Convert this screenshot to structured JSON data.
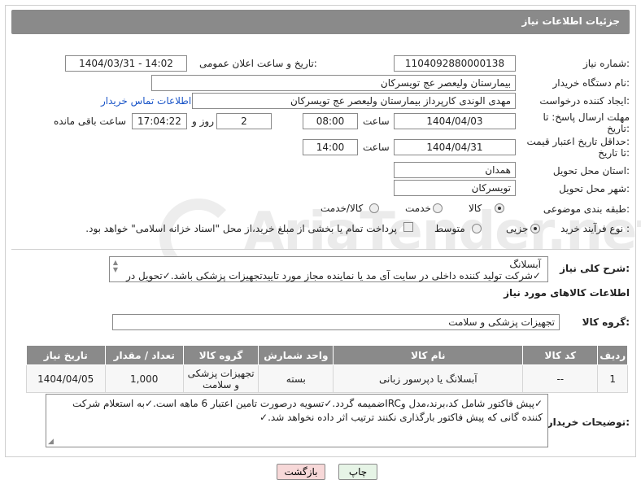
{
  "header": {
    "title": "جزئیات اطلاعات نیاز"
  },
  "form": {
    "need_number": {
      "label": "شماره نیاز:",
      "value": "1104092880000138"
    },
    "announce_datetime": {
      "label": "تاریخ و ساعت اعلان عمومی:",
      "value": "1404/03/31 - 14:02"
    },
    "buyer_org": {
      "label": "نام دستگاه خریدار:",
      "value": "بیمارستان ولیعصر  عج  تویسرکان"
    },
    "requester": {
      "label": "ایجاد کننده درخواست:",
      "value": "مهدی الوندی کارپرداز بیمارستان ولیعصر  عج  تویسرکان",
      "contact_link": "اطلاعات تماس خریدار"
    },
    "reply_deadline": {
      "label_line1": "مهلت ارسال پاسخ: تا",
      "label_line2": "تاریخ:",
      "date": "1404/04/03",
      "time_label": "ساعت",
      "time": "08:00",
      "days": "2",
      "days_label": "روز و",
      "remaining": "17:04:22",
      "remaining_label": "ساعت باقی مانده"
    },
    "price_validity": {
      "label_line1": "حداقل تاریخ اعتبار قیمت:",
      "label_line2": "تا تاریخ:",
      "date": "1404/04/31",
      "time_label": "ساعت",
      "time": "14:00"
    },
    "delivery_province": {
      "label": "استان محل تحویل:",
      "value": "همدان"
    },
    "delivery_city": {
      "label": "شهر محل تحویل:",
      "value": "تویسرکان"
    },
    "category": {
      "label": "طبقه بندی موضوعی:",
      "options": [
        "کالا",
        "خدمت",
        "کالا/خدمت"
      ],
      "selected": "کالا"
    },
    "purchase_process": {
      "label": "نوع فرآیند خرید :",
      "options": [
        "جزیی",
        "متوسط"
      ],
      "selected": "جزیی",
      "payment_note": "پرداخت تمام یا بخشی از مبلغ خرید،از محل \"اسناد خزانه اسلامی\" خواهد بود."
    }
  },
  "description": {
    "label": "شرح کلی نیاز:",
    "line1": "آبسلانگ",
    "line2": "✓شرکت تولید کننده داخلی در سایت آی مد یا نماینده مجاز مورد تاییدتجهیزات پزشکی باشد.✓تحویل در"
  },
  "goods_info": {
    "title": "اطلاعات کالاهای مورد نیاز",
    "group_label": "گروه کالا:",
    "group_value": "تجهیزات پزشکی و سلامت"
  },
  "table": {
    "headers": [
      "ردیف",
      "کد کالا",
      "نام کالا",
      "واحد شمارش",
      "گروه کالا",
      "تعداد / مقدار",
      "تاریخ نیاز"
    ],
    "rows": [
      [
        "1",
        "--",
        "آبسلانگ یا دپرسور زبانی",
        "بسته",
        "تجهیزات پزشکی و سلامت",
        "1,000",
        "1404/04/05"
      ]
    ]
  },
  "buyer_notes": {
    "label": "توضیحات خریدار:",
    "text": "✓پیش فاکتور شامل کد،برند،مدل وIRCضمیمه گردد.✓تسویه درصورت تامین اعتبار 6 ماهه است.✓به استعلام شرکت کننده گانی که پیش فاکتور بارگذاری نکنند ترتیب اثر داده نخواهد شد.✓"
  },
  "buttons": {
    "print": "چاپ",
    "back": "بازگشت"
  },
  "watermark": {
    "text": "AriaTender.net"
  },
  "colors": {
    "header": "#8a8a8a",
    "link": "#1a55c8",
    "back_button": "#f7d8d8",
    "print_button": "#e6f4e6"
  }
}
